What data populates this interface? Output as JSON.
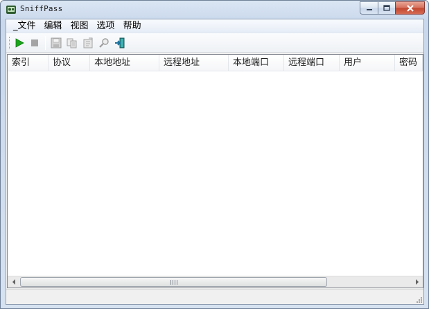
{
  "window": {
    "title": "SniffPass",
    "caption_buttons": {
      "minimize_icon": "minimize-icon",
      "maximize_icon": "maximize-icon",
      "close_icon": "close-icon"
    }
  },
  "menu": {
    "items": [
      {
        "label": "_文件"
      },
      {
        "label": "编辑"
      },
      {
        "label": "视图"
      },
      {
        "label": "选项"
      },
      {
        "label": "帮助"
      }
    ]
  },
  "toolbar": {
    "buttons": [
      {
        "icon": "start-capture-icon",
        "enabled": true
      },
      {
        "icon": "stop-capture-icon",
        "enabled": false
      },
      {
        "icon": "save-icon",
        "enabled": false
      },
      {
        "icon": "copy-icon",
        "enabled": false
      },
      {
        "icon": "properties-icon",
        "enabled": false
      },
      {
        "icon": "find-icon",
        "enabled": false
      },
      {
        "icon": "exit-icon",
        "enabled": true
      }
    ]
  },
  "table": {
    "columns": [
      {
        "label": "索引"
      },
      {
        "label": "协议"
      },
      {
        "label": "本地地址"
      },
      {
        "label": "远程地址"
      },
      {
        "label": "本地端口"
      },
      {
        "label": "远程端口"
      },
      {
        "label": "用户"
      },
      {
        "label": "密码"
      }
    ],
    "rows": []
  },
  "statusbar": {
    "text": ""
  },
  "colors": {
    "start_green": "#1aa51a",
    "title_bar": "#c9d8ec",
    "close_red": "#c2462f"
  }
}
